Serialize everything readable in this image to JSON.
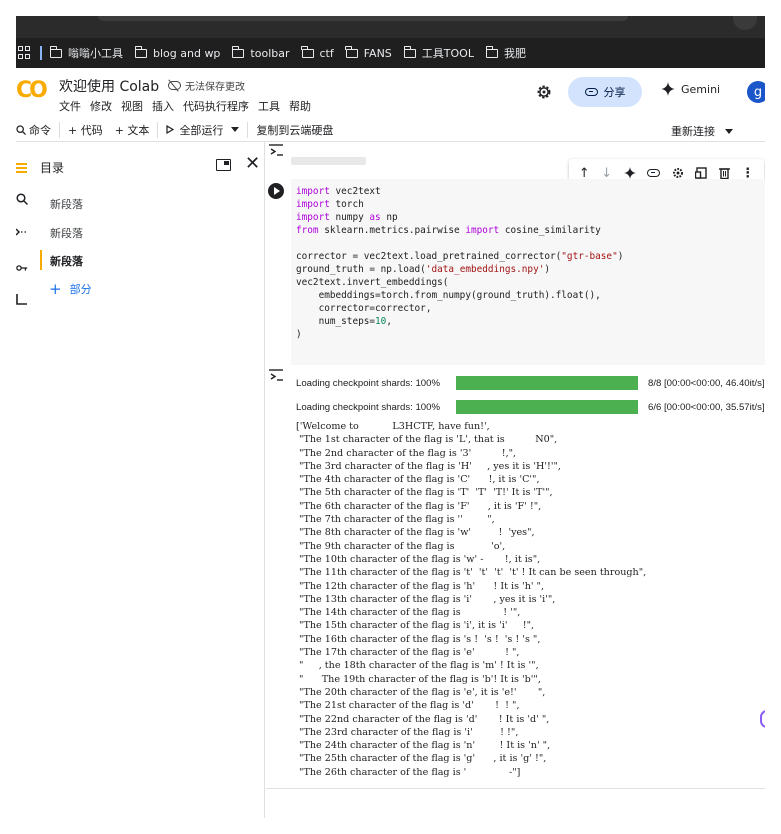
{
  "bookmarks": {
    "items": [
      "嗡嗡小工具",
      "blog and wp",
      "toolbar",
      "ctf",
      "FANS",
      "工具TOOL",
      "我肥"
    ]
  },
  "header": {
    "logo_text": "CO",
    "title": "欢迎使用 Colab",
    "save_status": "无法保存更改",
    "menu": [
      "文件",
      "修改",
      "视图",
      "插入",
      "代码执行程序",
      "工具",
      "帮助"
    ],
    "share_label": "分享",
    "gemini_label": "Gemini",
    "avatar_letter": "g"
  },
  "toolbar": {
    "command_label": "命令",
    "add_code_label": "+ 代码",
    "add_text_label": "+ 文本",
    "run_all_label": "全部运行",
    "copy_to_drive_label": "复制到云端硬盘",
    "reconnect_label": "重新连接"
  },
  "sidebar": {
    "title": "目录",
    "items": [
      {
        "label": "新段落",
        "active": false
      },
      {
        "label": "新段落",
        "active": false
      },
      {
        "label": "新段落",
        "active": true
      }
    ],
    "add_section_label": "部分"
  },
  "code_cell": {
    "lines": [
      [
        {
          "t": "import",
          "c": "kw"
        },
        {
          "t": " vec2text",
          "c": ""
        }
      ],
      [
        {
          "t": "import",
          "c": "kw"
        },
        {
          "t": " torch",
          "c": ""
        }
      ],
      [
        {
          "t": "import",
          "c": "kw"
        },
        {
          "t": " numpy ",
          "c": ""
        },
        {
          "t": "as",
          "c": "kw"
        },
        {
          "t": " np",
          "c": ""
        }
      ],
      [
        {
          "t": "from",
          "c": "kw"
        },
        {
          "t": " sklearn.metrics.pairwise ",
          "c": ""
        },
        {
          "t": "import",
          "c": "kw"
        },
        {
          "t": " cosine_similarity",
          "c": ""
        }
      ],
      [
        {
          "t": "",
          "c": ""
        }
      ],
      [
        {
          "t": "corrector = vec2text.load_pretrained_corrector(",
          "c": ""
        },
        {
          "t": "\"gtr-base\"",
          "c": "str"
        },
        {
          "t": ")",
          "c": ""
        }
      ],
      [
        {
          "t": "ground_truth = np.load(",
          "c": ""
        },
        {
          "t": "'data_embeddings.npy'",
          "c": "str"
        },
        {
          "t": ")",
          "c": ""
        }
      ],
      [
        {
          "t": "vec2text.invert_embeddings(",
          "c": ""
        }
      ],
      [
        {
          "t": "    embeddings=torch.from_numpy(ground_truth).float(),",
          "c": ""
        }
      ],
      [
        {
          "t": "    corrector=corrector,",
          "c": ""
        }
      ],
      [
        {
          "t": "    num_steps=",
          "c": ""
        },
        {
          "t": "10",
          "c": "num"
        },
        {
          "t": ",",
          "c": ""
        }
      ],
      [
        {
          "t": ")",
          "c": ""
        }
      ]
    ]
  },
  "progress": [
    {
      "label": "Loading checkpoint shards: 100%",
      "fraction": 1.0,
      "stats": "8/8 [00:00<00:00, 46.40it/s]"
    },
    {
      "label": "Loading checkpoint shards: 100%",
      "fraction": 1.0,
      "stats": "6/6 [00:00<00:00, 35.57it/s]"
    }
  ],
  "output_lines": [
    "['Welcome to           L3HCTF, have fun!',",
    " \"The 1st character of the flag is 'L', that is          N0\",",
    " \"The 2nd character of the flag is '3'          !,\",",
    " \"The 3rd character of the flag is 'H'     , yes it is 'H'!'\",",
    " \"The 4th character of the flag is 'C'      !, it is 'C'\",",
    " \"The 5th character of the flag is 'T'  'T'  'T!' It is 'T'\",",
    " \"The 6th character of the flag is 'F'      , it is 'F' !\",",
    " \"The 7th character of the flag is ''        \",",
    " \"The 8th character of the flag is 'w'         !  'yes\",",
    " \"The 9th character of the flag is            'o',",
    " \"The 10th character of the flag is 'w' -       !, it is\",",
    " \"The 11th character of the flag is 't'  't'  't'  't' ! It can be seen through\",",
    " \"The 12th character of the flag is 'h'      ! It is 'h' \",",
    " \"The 13th character of the flag is 'i'       , yes it is 'i'\",",
    " \"The 14th character of the flag is              ! '\",",
    " \"The 15th character of the flag is 'i', it is 'i'     !\",",
    " \"The 16th character of the flag is 's !  's !  's ! 's \",",
    " \"The 17th character of the flag is 'e'          ! \",",
    " \"     , the 18th character of the flag is 'm' ! It is '\",",
    " \"      The 19th character of the flag is 'b'! It is 'b'\",",
    " \"The 20th character of the flag is 'e', it is 'e!'       \",",
    " \"The 21st character of the flag is 'd'       !  ! \",",
    " \"The 22nd character of the flag is 'd'       ! It is 'd' \",",
    " \"The 23rd character of the flag is 'i'         ! !\",",
    " \"The 24th character of the flag is 'n'        ! It is 'n' \",",
    " \"The 25th character of the flag is 'g'      , it is 'g' !\",",
    " \"The 26th character of the flag is '              -\"]"
  ],
  "colors": {
    "accent": "#f9ab00",
    "share_bg": "#d3e3fd",
    "progress_green": "#4caf50",
    "keyword": "#af00db",
    "string": "#a31515"
  }
}
